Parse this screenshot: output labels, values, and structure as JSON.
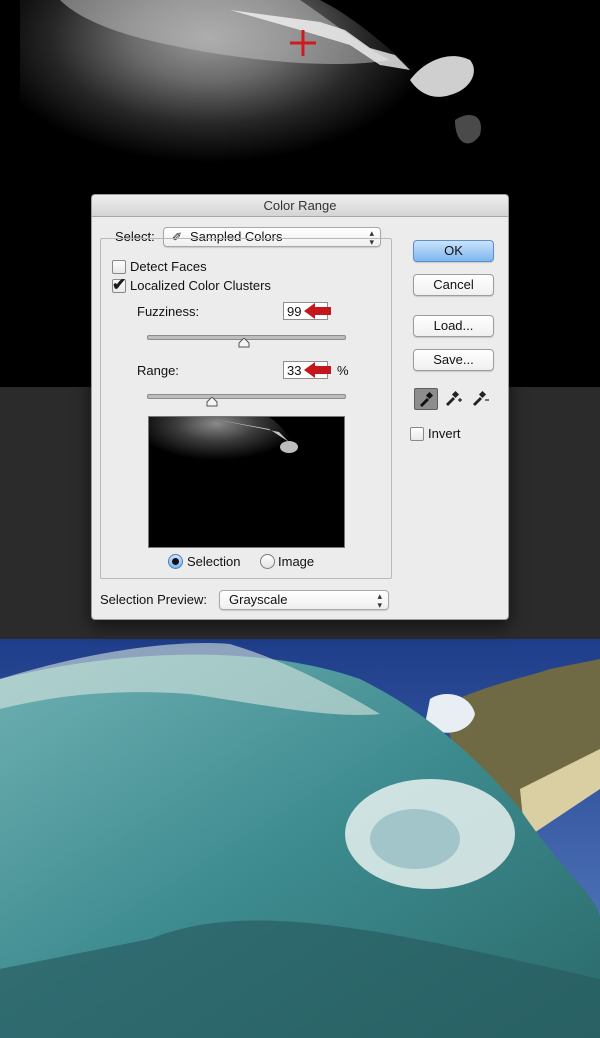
{
  "dialog": {
    "title": "Color Range",
    "select_label": "Select:",
    "select_value": "Sampled Colors",
    "detect_faces_label": "Detect Faces",
    "detect_faces_checked": false,
    "localized_label": "Localized Color Clusters",
    "localized_checked": true,
    "fuzziness_label": "Fuzziness:",
    "fuzziness_value": "99",
    "fuzziness_slider_fraction": 0.49,
    "range_label": "Range:",
    "range_value": "33",
    "range_unit": "%",
    "range_slider_fraction": 0.33,
    "selection_label": "Selection",
    "image_label": "Image",
    "view_mode": "Selection",
    "preview_mode_label": "Selection Preview:",
    "preview_mode_value": "Grayscale",
    "ok_label": "OK",
    "cancel_label": "Cancel",
    "load_label": "Load...",
    "save_label": "Save...",
    "invert_label": "Invert",
    "invert_checked": false,
    "droppers": [
      "eyedropper-icon",
      "eyedropper-plus-icon",
      "eyedropper-minus-icon"
    ]
  },
  "colors": {
    "annotation_arrow": "#c4161c",
    "sample_crosshair": "#d11a20",
    "ok_button": "#7eb7ee"
  }
}
